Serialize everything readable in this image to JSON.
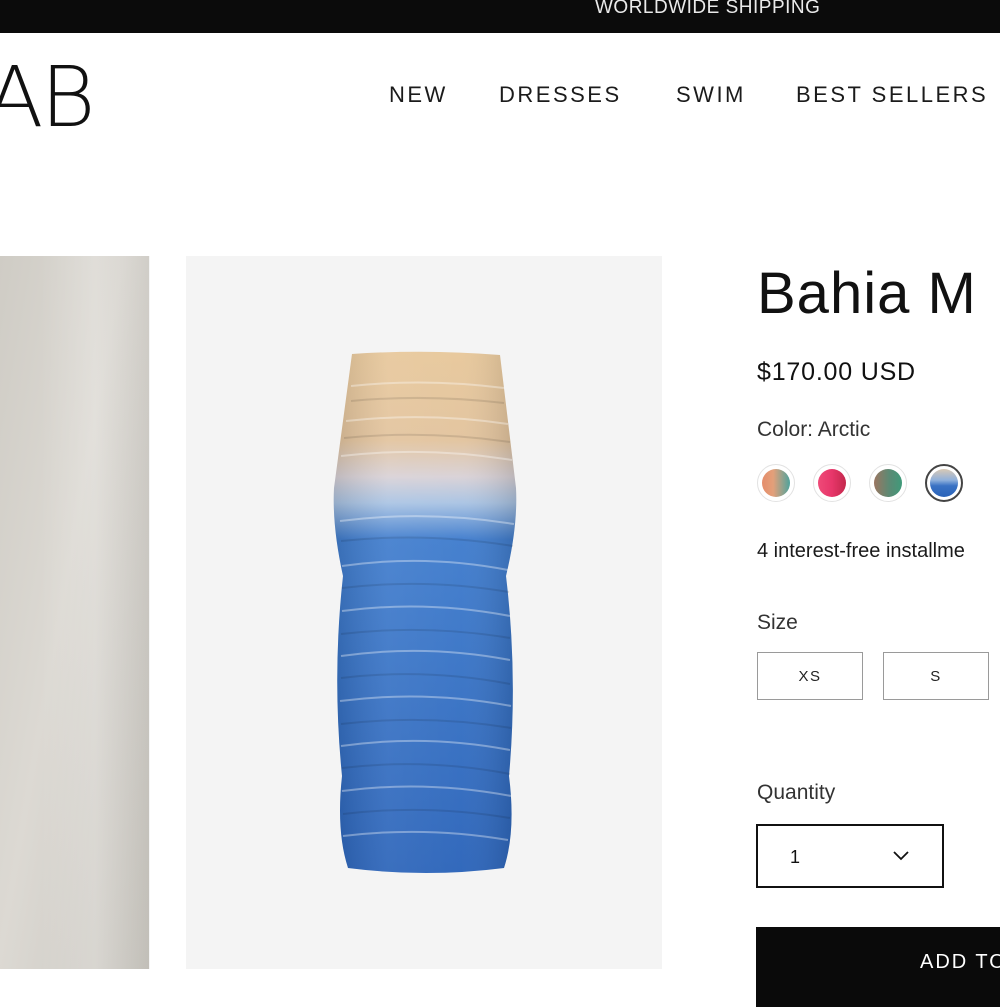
{
  "announcement": "WORLDWIDE SHIPPING",
  "logo": "AB",
  "nav": [
    "NEW",
    "DRESSES",
    "SWIM",
    "BEST SELLERS"
  ],
  "product": {
    "title": "Bahia M",
    "price": "$170.00 USD",
    "color_label": "Color: Arctic",
    "swatches": [
      {
        "name": "coral-green",
        "color": "#e58d6b",
        "selected": false
      },
      {
        "name": "pink-red",
        "color": "#e43c6a",
        "selected": false
      },
      {
        "name": "green-brown",
        "color": "#5b8a74",
        "selected": false
      },
      {
        "name": "arctic",
        "color": "#3a72c4",
        "selected": true
      }
    ],
    "installments": "4 interest-free installme",
    "size_label": "Size",
    "sizes": [
      "XS",
      "S"
    ],
    "quantity_label": "Quantity",
    "quantity": "1",
    "add_to_cart": "ADD TO"
  },
  "icons": {
    "quantity_dropdown": "chevron-down-icon"
  }
}
